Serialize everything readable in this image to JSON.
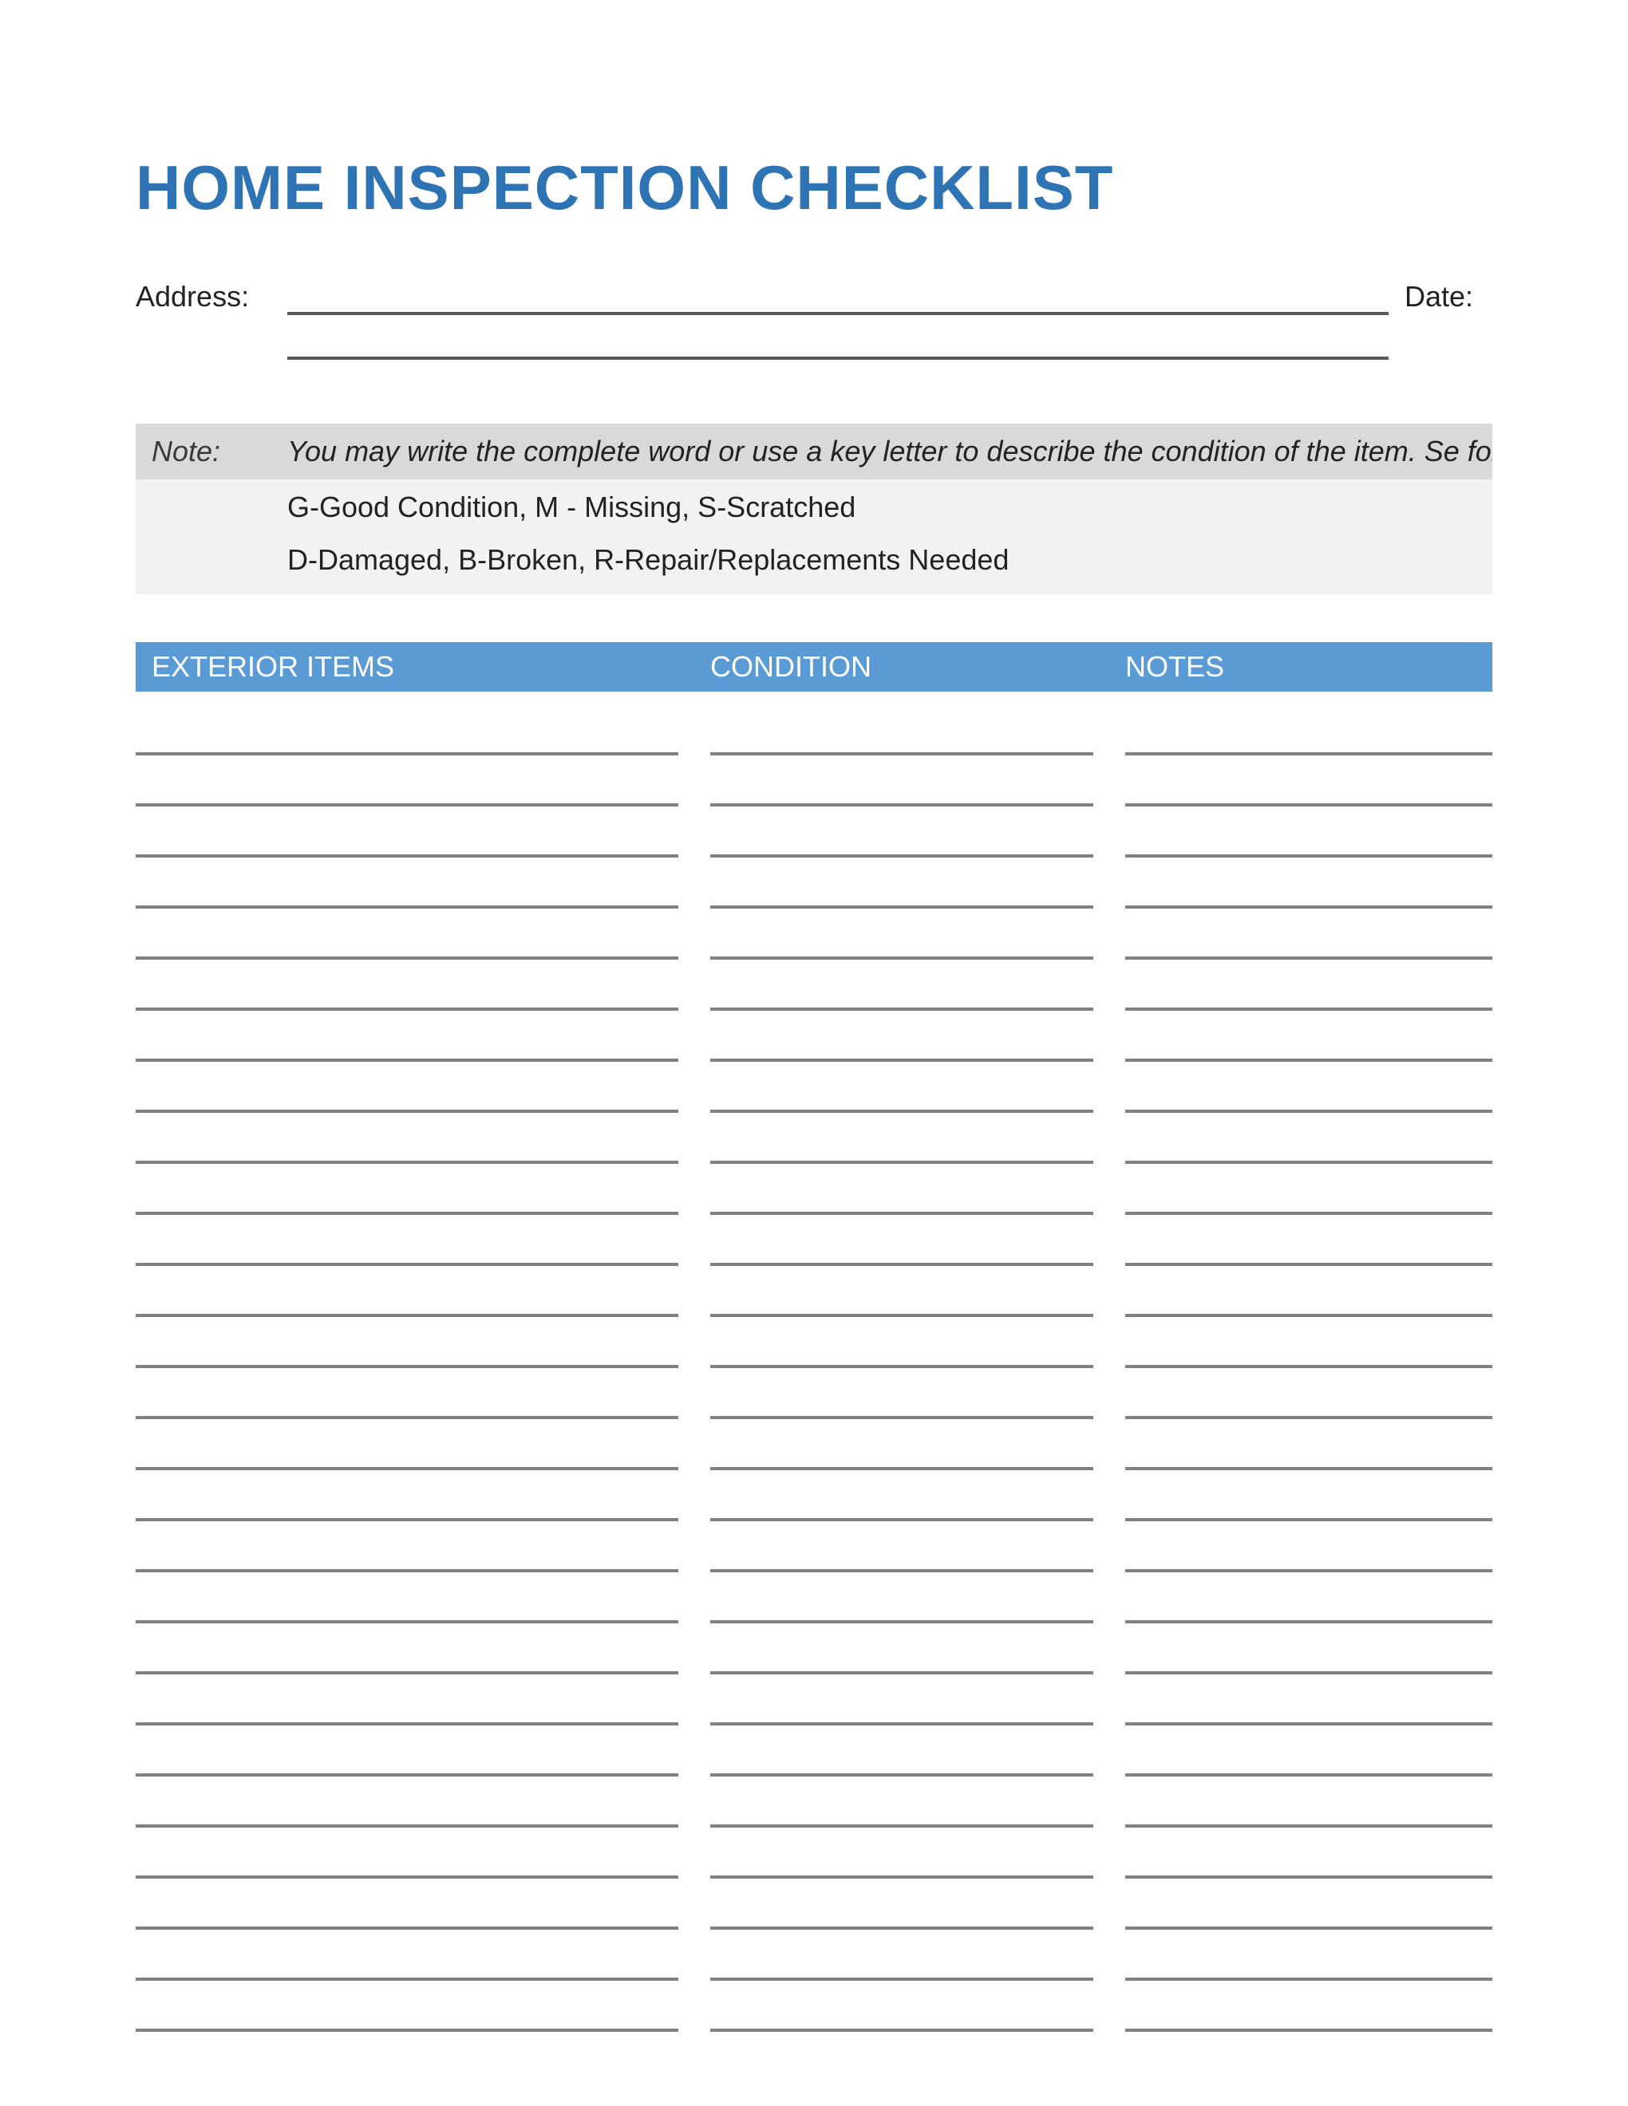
{
  "title": "HOME INSPECTION CHECKLIST",
  "header": {
    "address_label": "Address:",
    "date_label": "Date:"
  },
  "note": {
    "label": "Note:",
    "description": "You may write the complete word or use a key letter to describe the condition of the item. Se following examples.",
    "legend1": "G-Good Condition, M - Missing, S-Scratched",
    "legend2": "D-Damaged, B-Broken, R-Repair/Replacements Needed"
  },
  "table": {
    "col_items": "EXTERIOR ITEMS",
    "col_condition": "CONDITION",
    "col_notes": "NOTES",
    "row_count": 26
  }
}
